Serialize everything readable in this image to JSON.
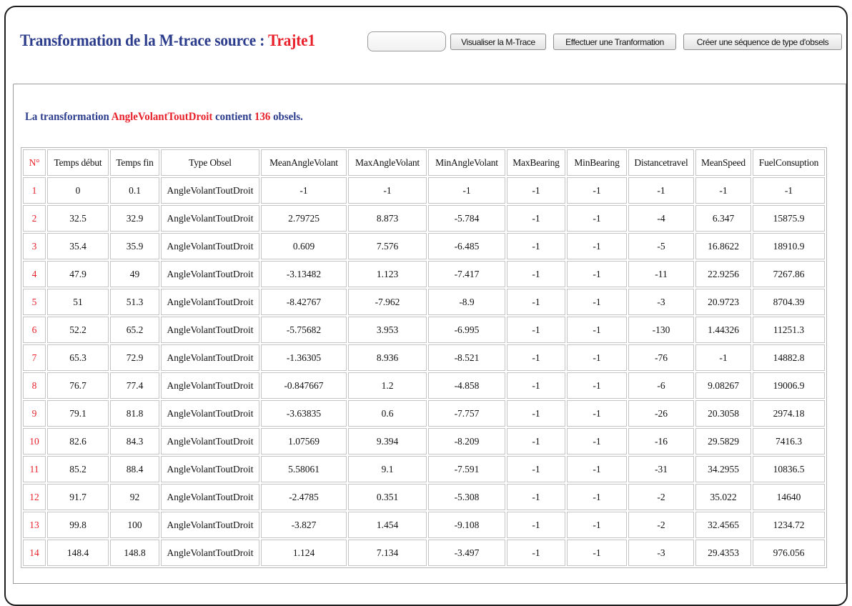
{
  "header": {
    "title_prefix": "Transformation de la M-trace source : ",
    "source_name": "Trajte1"
  },
  "toolbar": {
    "trace_input_value": "",
    "visualize_label": "Visualiser la M-Trace",
    "transform_label": "Effectuer une Tranformation",
    "create_sequence_label": "Créer une séquence de type d'obsels"
  },
  "summary": {
    "prefix": "La transformation ",
    "transformation_name": "AngleVolantToutDroit",
    "middle": " contient ",
    "count": "136",
    "suffix": " obsels."
  },
  "table": {
    "headers": [
      "N°",
      "Temps début",
      "Temps fin",
      "Type Obsel",
      "MeanAngleVolant",
      "MaxAngleVolant",
      "MinAngleVolant",
      "MaxBearing",
      "MinBearing",
      "Distancetravel",
      "MeanSpeed",
      "FuelConsuption"
    ],
    "rows": [
      [
        "1",
        "0",
        "0.1",
        "AngleVolantToutDroit",
        "-1",
        "-1",
        "-1",
        "-1",
        "-1",
        "-1",
        "-1",
        "-1"
      ],
      [
        "2",
        "32.5",
        "32.9",
        "AngleVolantToutDroit",
        "2.79725",
        "8.873",
        "-5.784",
        "-1",
        "-1",
        "-4",
        "6.347",
        "15875.9"
      ],
      [
        "3",
        "35.4",
        "35.9",
        "AngleVolantToutDroit",
        "0.609",
        "7.576",
        "-6.485",
        "-1",
        "-1",
        "-5",
        "16.8622",
        "18910.9"
      ],
      [
        "4",
        "47.9",
        "49",
        "AngleVolantToutDroit",
        "-3.13482",
        "1.123",
        "-7.417",
        "-1",
        "-1",
        "-11",
        "22.9256",
        "7267.86"
      ],
      [
        "5",
        "51",
        "51.3",
        "AngleVolantToutDroit",
        "-8.42767",
        "-7.962",
        "-8.9",
        "-1",
        "-1",
        "-3",
        "20.9723",
        "8704.39"
      ],
      [
        "6",
        "52.2",
        "65.2",
        "AngleVolantToutDroit",
        "-5.75682",
        "3.953",
        "-6.995",
        "-1",
        "-1",
        "-130",
        "1.44326",
        "11251.3"
      ],
      [
        "7",
        "65.3",
        "72.9",
        "AngleVolantToutDroit",
        "-1.36305",
        "8.936",
        "-8.521",
        "-1",
        "-1",
        "-76",
        "-1",
        "14882.8"
      ],
      [
        "8",
        "76.7",
        "77.4",
        "AngleVolantToutDroit",
        "-0.847667",
        "1.2",
        "-4.858",
        "-1",
        "-1",
        "-6",
        "9.08267",
        "19006.9"
      ],
      [
        "9",
        "79.1",
        "81.8",
        "AngleVolantToutDroit",
        "-3.63835",
        "0.6",
        "-7.757",
        "-1",
        "-1",
        "-26",
        "20.3058",
        "2974.18"
      ],
      [
        "10",
        "82.6",
        "84.3",
        "AngleVolantToutDroit",
        "1.07569",
        "9.394",
        "-8.209",
        "-1",
        "-1",
        "-16",
        "29.5829",
        "7416.3"
      ],
      [
        "11",
        "85.2",
        "88.4",
        "AngleVolantToutDroit",
        "5.58061",
        "9.1",
        "-7.591",
        "-1",
        "-1",
        "-31",
        "34.2955",
        "10836.5"
      ],
      [
        "12",
        "91.7",
        "92",
        "AngleVolantToutDroit",
        "-2.4785",
        "0.351",
        "-5.308",
        "-1",
        "-1",
        "-2",
        "35.022",
        "14640"
      ],
      [
        "13",
        "99.8",
        "100",
        "AngleVolantToutDroit",
        "-3.827",
        "1.454",
        "-9.108",
        "-1",
        "-1",
        "-2",
        "32.4565",
        "1234.72"
      ],
      [
        "14",
        "148.4",
        "148.8",
        "AngleVolantToutDroit",
        "1.124",
        "7.134",
        "-3.497",
        "-1",
        "-1",
        "-3",
        "29.4353",
        "976.056"
      ]
    ]
  }
}
